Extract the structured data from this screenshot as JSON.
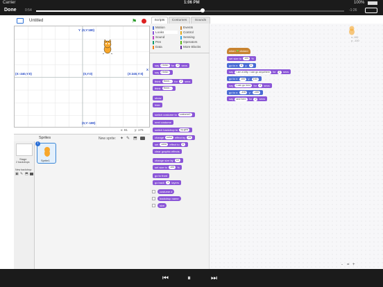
{
  "status": {
    "carrier": "Carrier",
    "time": "1:06 PM",
    "battery": "100%"
  },
  "player": {
    "done": "Done",
    "elapsed": "0:54",
    "remaining": "-1:26",
    "progress": 0.54
  },
  "project": {
    "title": "Untitled"
  },
  "stage": {
    "labels": {
      "top": "(0,Y:180)",
      "bottom": "(0,Y:-180)",
      "left": "(X:-240,Y:0)",
      "right": "(X:240,Y:0)",
      "center": "(0,Y:0)",
      "x_axis": "X",
      "y_axis": "Y"
    },
    "mouse": {
      "x_label": "x: 81",
      "y_label": "y: 176"
    }
  },
  "tabs": [
    "Scripts",
    "Costumes",
    "Sounds"
  ],
  "categories": [
    {
      "label": "Motion",
      "color": "#4a6cd4"
    },
    {
      "label": "Events",
      "color": "#c88330"
    },
    {
      "label": "Looks",
      "color": "#8a55d7"
    },
    {
      "label": "Control",
      "color": "#e1a91a"
    },
    {
      "label": "Sound",
      "color": "#bb42c3"
    },
    {
      "label": "Sensing",
      "color": "#2ca5e2"
    },
    {
      "label": "Pen",
      "color": "#0e9a6c"
    },
    {
      "label": "Operators",
      "color": "#5cb712"
    },
    {
      "label": "Data",
      "color": "#ee7d16"
    },
    {
      "label": "More Blocks",
      "color": "#632d99"
    }
  ],
  "palette": [
    {
      "pre": "say",
      "in": "Hello!",
      "mid": "for",
      "in2": "2",
      "post": "secs"
    },
    {
      "pre": "say",
      "in": "Hello!"
    },
    {
      "pre": "think",
      "in": "Hmm...",
      "mid": "for",
      "in2": "2",
      "post": "secs"
    },
    {
      "pre": "think",
      "in": "Hmm..."
    },
    {
      "pre": "show"
    },
    {
      "pre": "hide"
    },
    {
      "pre": "switch costume to",
      "in": "costume2"
    },
    {
      "pre": "next costume"
    },
    {
      "pre": "switch backdrop to",
      "in": "xy-grid"
    },
    {
      "pre": "change",
      "in": "color",
      "mid": "effect by",
      "in2": "25"
    },
    {
      "pre": "set",
      "in": "color",
      "mid": "effect to",
      "in2": "0"
    },
    {
      "pre": "clear graphic effects"
    },
    {
      "pre": "change size by",
      "in": "10"
    },
    {
      "pre": "set size to",
      "in": "100",
      "post": "%"
    },
    {
      "pre": "go to front"
    },
    {
      "pre": "go back",
      "in": "1",
      "post": "layers"
    },
    {
      "pre": "costume #"
    },
    {
      "pre": "backdrop name"
    },
    {
      "pre": "size"
    }
  ],
  "script": {
    "hat": {
      "pre": "when",
      "post": "clicked"
    },
    "blocks": [
      {
        "pre": "set size to",
        "in": "100",
        "post": "%"
      },
      {
        "pre": "go to x:",
        "in": "0",
        "mid": "y:",
        "in2": "0"
      },
      {
        "pre": "say",
        "in": "I am a kitty. I can go anywhere",
        "mid": "for",
        "in2": "2",
        "post": "secs"
      },
      {
        "pre": "go to x:",
        "in": "100",
        "mid": "y:",
        "in2": "100"
      },
      {
        "pre": "say",
        "in": "I can go here",
        "mid": "for",
        "in2": "2",
        "post": "secs"
      },
      {
        "pre": "go to x:",
        "in": "-100",
        "mid": "y:",
        "in2": "-100"
      },
      {
        "pre": "say",
        "in": "and here",
        "mid": "for",
        "in2": "2",
        "post": "secs"
      }
    ]
  },
  "sprite_info": {
    "x": "x: 100",
    "y": "y: -100"
  },
  "sprites_panel": {
    "title": "Sprites",
    "new_sprite": "New sprite:",
    "stage_label": "Stage",
    "stage_sub": "2 backdrops",
    "new_backdrop": "New backdrop:",
    "sprite_name": "Sprite1"
  },
  "zoom": {
    "out": "-",
    "reset": "=",
    "in": "+"
  }
}
